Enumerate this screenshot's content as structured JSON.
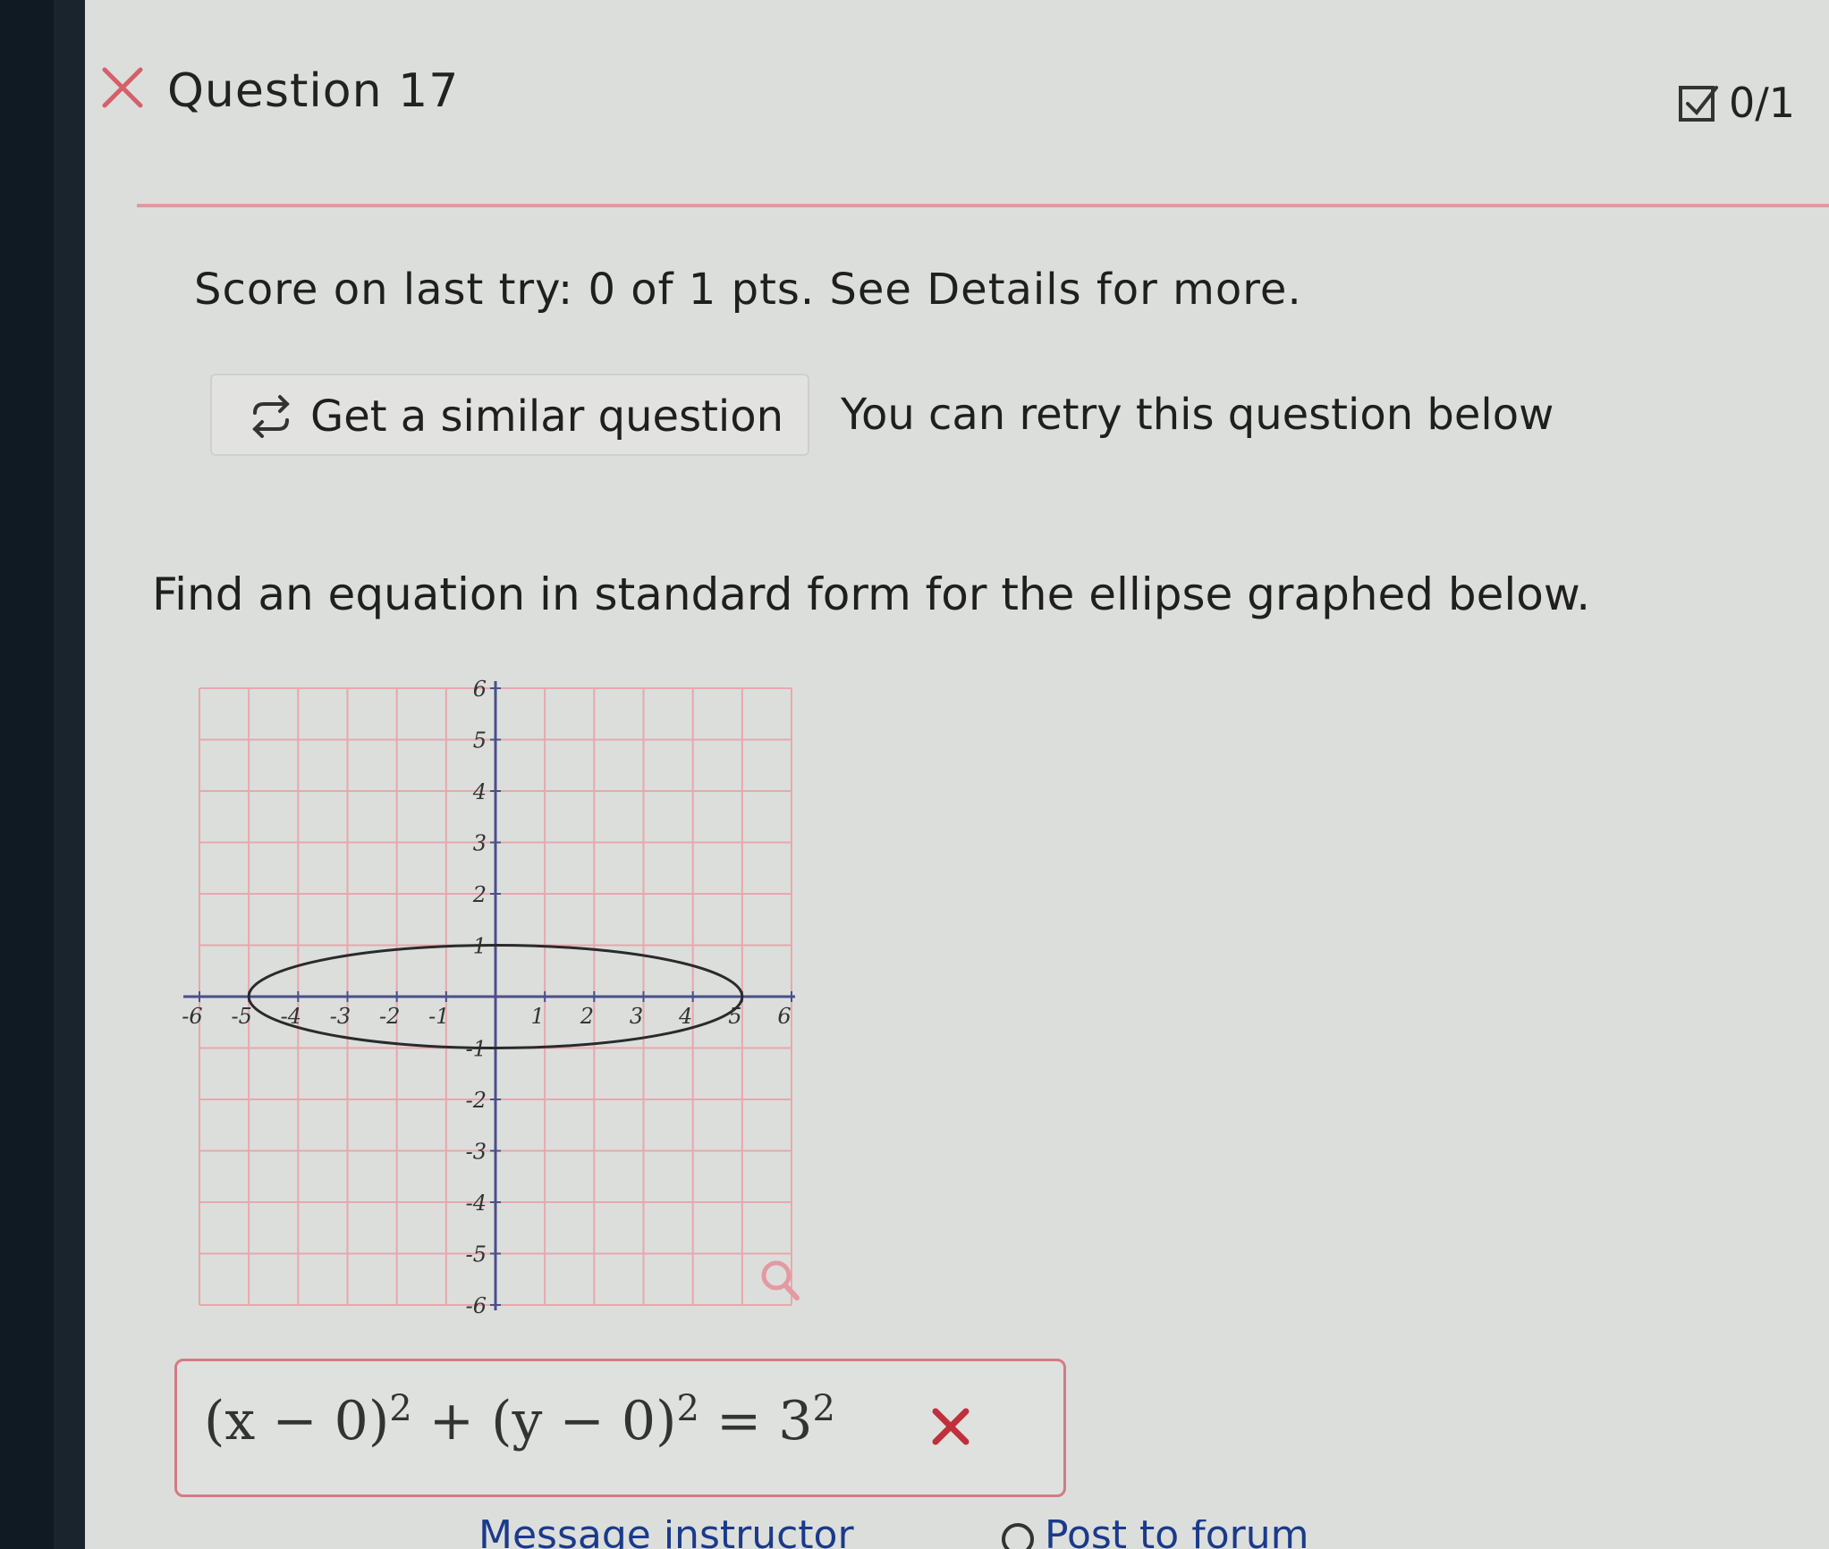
{
  "question": {
    "title": "Question 17",
    "score": "0/1"
  },
  "score_line": "Score on last try: 0 of 1 pts. See Details for more.",
  "similar_button": {
    "label": "Get a similar question"
  },
  "retry_text": "You can retry this question below",
  "prompt": "Find an equation in standard form for the ellipse graphed below.",
  "graph": {
    "x_ticks": [
      "-6",
      "-5",
      "-4",
      "-3",
      "-2",
      "-1",
      "1",
      "2",
      "3",
      "4",
      "5",
      "6"
    ],
    "y_ticks": [
      "6",
      "5",
      "4",
      "3",
      "2",
      "1",
      "-1",
      "-2",
      "-3",
      "-4",
      "-5",
      "-6"
    ],
    "range": [
      -6,
      6
    ],
    "ellipse": {
      "cx": 0,
      "cy": 0,
      "rx": 5,
      "ry": 1
    },
    "colors": {
      "grid": "#e6a8ae",
      "axis": "#4a4f8a",
      "curve": "#2a2a2a"
    }
  },
  "answer": {
    "parts": [
      "(x − 0)",
      "2",
      " + (y − 0)",
      "2",
      " = 3",
      "2"
    ]
  },
  "bottom": {
    "message_label": "Message instructor",
    "forum_label": "Post to forum"
  },
  "icons": {
    "incorrect": "x-mark-icon",
    "score": "checkbox-icon",
    "similar": "refresh-icon",
    "zoom": "magnifier-icon"
  }
}
